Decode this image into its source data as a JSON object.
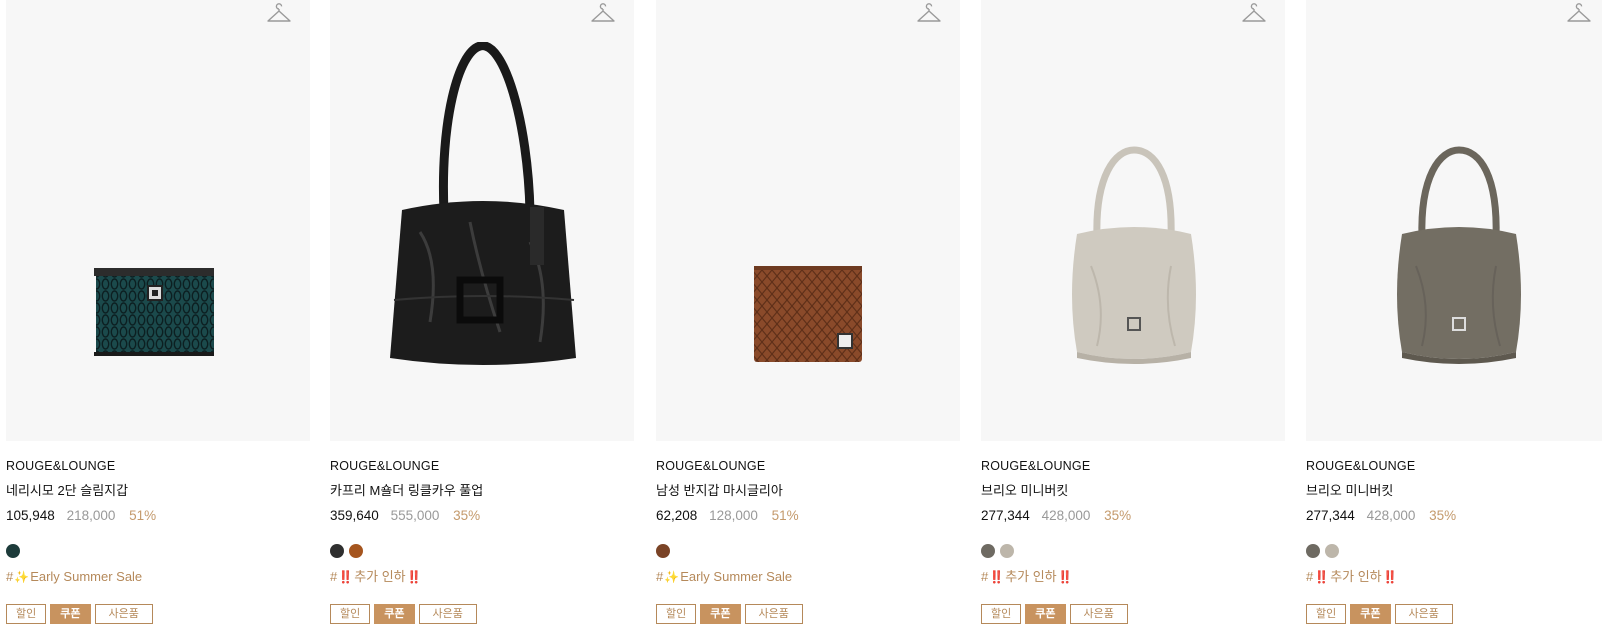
{
  "products": [
    {
      "brand": "ROUGE&LOUNGE",
      "name": "네리시모 2단 슬림지갑",
      "price": "105,948",
      "original_price": "218,000",
      "discount": "51%",
      "swatches": [
        "#1d3b3a"
      ],
      "tag_prefix": "#",
      "tag_icon": "✨",
      "tag_text": "Early Summer Sale",
      "tag_suffix_icon": "",
      "badges": [
        "할인",
        "쿠폰",
        "사은품"
      ]
    },
    {
      "brand": "ROUGE&LOUNGE",
      "name": "카프리 M숄더 링클카우 풀업",
      "price": "359,640",
      "original_price": "555,000",
      "discount": "35%",
      "swatches": [
        "#2f2f2f",
        "#a5551e"
      ],
      "tag_prefix": "#",
      "tag_icon": "‼️",
      "tag_text": "추가 인하",
      "tag_suffix_icon": "‼️",
      "badges": [
        "할인",
        "쿠폰",
        "사은품"
      ]
    },
    {
      "brand": "ROUGE&LOUNGE",
      "name": "남성 반지갑 마시글리아",
      "price": "62,208",
      "original_price": "128,000",
      "discount": "51%",
      "swatches": [
        "#7a4326"
      ],
      "tag_prefix": "#",
      "tag_icon": "✨",
      "tag_text": "Early Summer Sale",
      "tag_suffix_icon": "",
      "badges": [
        "할인",
        "쿠폰",
        "사은품"
      ]
    },
    {
      "brand": "ROUGE&LOUNGE",
      "name": "브리오 미니버킷",
      "price": "277,344",
      "original_price": "428,000",
      "discount": "35%",
      "swatches": [
        "#6e6a62",
        "#bdb6aa"
      ],
      "tag_prefix": "#",
      "tag_icon": "‼️",
      "tag_text": "추가 인하",
      "tag_suffix_icon": "‼️",
      "badges": [
        "할인",
        "쿠폰",
        "사은품"
      ]
    },
    {
      "brand": "ROUGE&LOUNGE",
      "name": "브리오 미니버킷",
      "price": "277,344",
      "original_price": "428,000",
      "discount": "35%",
      "swatches": [
        "#6e6a62",
        "#bdb6aa"
      ],
      "tag_prefix": "#",
      "tag_icon": "‼️",
      "tag_text": "추가 인하",
      "tag_suffix_icon": "‼️",
      "badges": [
        "할인",
        "쿠폰",
        "사은품"
      ]
    }
  ],
  "icons": {
    "hanger": "hanger-icon"
  },
  "colors": {
    "accent": "#c8935f",
    "discount": "#c49a6c",
    "original_price": "#999999",
    "image_bg": "#f7f7f7"
  }
}
